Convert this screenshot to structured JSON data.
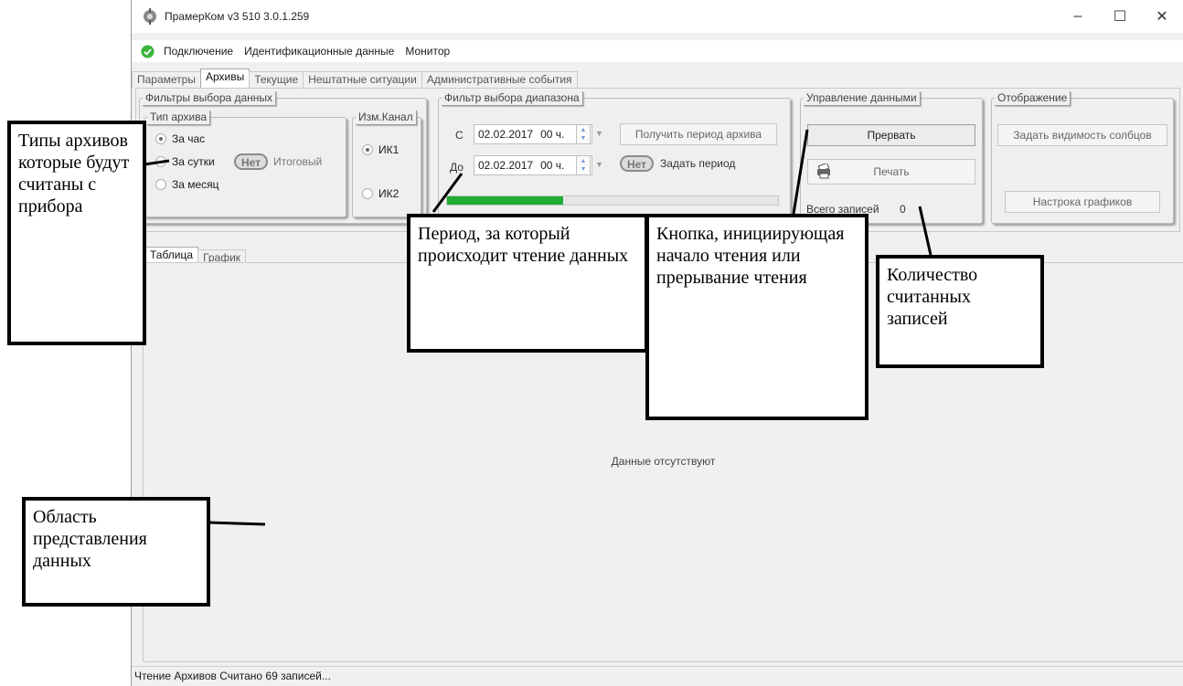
{
  "window": {
    "title": "ПрамерКом v3 510 3.0.1.259",
    "minimize": "–",
    "maximize": "☐",
    "close": "✕"
  },
  "menu": [
    "Подключение",
    "Идентификационные данные",
    "Монитор"
  ],
  "main_tabs": [
    "Параметры",
    "Архивы",
    "Текущие",
    "Нештатные ситуации",
    "Административные события"
  ],
  "filters": {
    "title": "Фильтры выбора данных",
    "archive_type": {
      "title": "Тип архива",
      "options": [
        "За час",
        "За сутки",
        "За месяц"
      ],
      "selected": "За час",
      "toggle": "Нет",
      "summary_label": "Итоговый"
    },
    "channel": {
      "title": "Изм.Канал",
      "options": [
        "ИК1",
        "ИК2"
      ],
      "selected": "ИК1"
    }
  },
  "range": {
    "title": "Фильтр выбора диапазона",
    "from_label": "С",
    "to_label": "До",
    "from_date": "02.02.2017",
    "from_hour": "00 ч.",
    "to_date": "02.02.2017",
    "to_hour": "00 ч.",
    "get_period_button": "Получить период архива",
    "set_period_toggle": "Нет",
    "set_period_label": "Задать период",
    "progress": 0.35
  },
  "data_control": {
    "title": "Управление данными",
    "abort_button": "Прервать",
    "print_button": "Печать",
    "records_label": "Всего записей",
    "records_count": "0"
  },
  "display": {
    "title": "Отображение",
    "columns_button": "Задать видимость солбцов",
    "charts_button": "Настрока графиков"
  },
  "data_tabs": [
    "Таблица",
    "График"
  ],
  "no_data": "Данные отсутствуют",
  "status": "Чтение Архивов Считано 69 записей...",
  "annotations": {
    "archive_types": "Типы архивов которые будут считаны с прибора",
    "period": "Период, за который происходит чтение данных",
    "button": "Кнопка, инициирующая начало чтения или прерывание чтения",
    "count": "Количество считанных записей",
    "data_area": "Область представления данных"
  },
  "colors": {
    "progress": "#1fae33",
    "ok_icon": "#3cb43c"
  }
}
